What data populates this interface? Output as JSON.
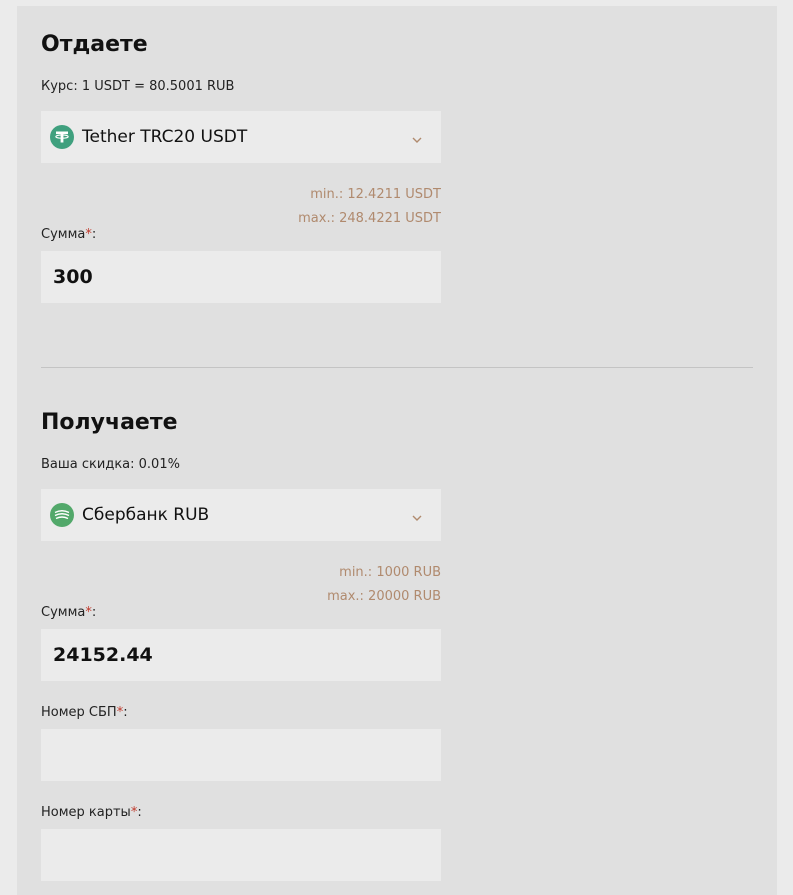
{
  "give": {
    "title": "Отдаете",
    "rate_text": "Курс: 1 USDT = 80.5001 RUB",
    "currency_label": "Tether TRC20 USDT",
    "min_text": "min.: 12.4211 USDT",
    "max_text": "max.: 248.4221 USDT",
    "amount_label": "Сумма",
    "amount_value": "300"
  },
  "get": {
    "title": "Получаете",
    "discount_text": "Ваша скидка: 0.01%",
    "currency_label": "Сбербанк RUB",
    "min_text": "min.: 1000 RUB",
    "max_text": "max.: 20000 RUB",
    "amount_label": "Сумма",
    "amount_value": "24152.44",
    "sbp_label": "Номер СБП",
    "sbp_value": "",
    "card_label": "Номер карты",
    "card_value": ""
  },
  "required_mark": "*",
  "label_suffix": ":",
  "icons": {
    "give_currency": "tether-icon",
    "get_currency": "sberbank-icon",
    "dropdown": "chevron-down-icon"
  },
  "colors": {
    "tether": "#3fa07e",
    "sberbank": "#52a86a",
    "limits": "#b08a6e",
    "required": "#c0392b"
  }
}
